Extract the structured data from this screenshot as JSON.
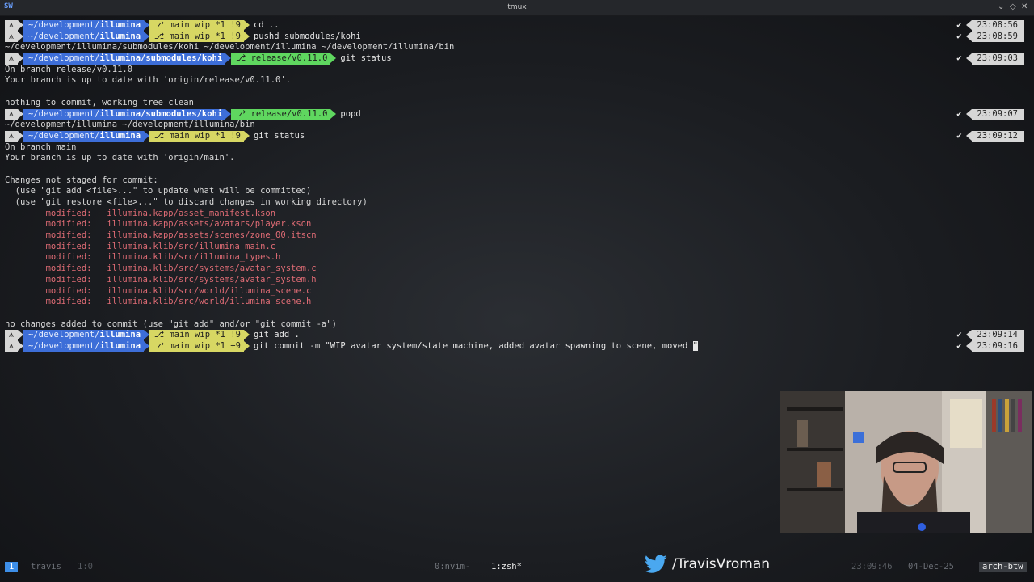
{
  "window": {
    "title": "tmux",
    "icon": "terminal-app-icon",
    "controls": [
      "chevron-down-icon",
      "diamond-icon",
      "close-icon"
    ]
  },
  "prompt": {
    "os_icon": "arch-linux-icon",
    "dir_prefix": "~/development/",
    "branch_icon": "branch-icon"
  },
  "terminal": {
    "lines": [
      {
        "type": "prompt",
        "dir": "illumina",
        "git": "⎇ main wip *1 !9",
        "clean": false,
        "cmd": "cd ..",
        "status": "✔",
        "time": "23:08:56"
      },
      {
        "type": "prompt",
        "dir": "illumina",
        "git": "⎇ main wip *1 !9",
        "clean": false,
        "cmd": "pushd submodules/kohi",
        "status": "✔",
        "time": "23:08:59"
      },
      {
        "type": "out",
        "text": "~/development/illumina/submodules/kohi ~/development/illumina ~/development/illumina/bin"
      },
      {
        "type": "prompt",
        "dir": "illumina/submodules/kohi",
        "git": "⎇ release/v0.11.0",
        "clean": true,
        "cmd": "git status",
        "status": "✔",
        "time": "23:09:03"
      },
      {
        "type": "out",
        "text": "On branch release/v0.11.0"
      },
      {
        "type": "out",
        "text": "Your branch is up to date with 'origin/release/v0.11.0'."
      },
      {
        "type": "out",
        "text": ""
      },
      {
        "type": "out",
        "text": "nothing to commit, working tree clean"
      },
      {
        "type": "prompt",
        "dir": "illumina/submodules/kohi",
        "git": "⎇ release/v0.11.0",
        "clean": true,
        "cmd": "popd",
        "status": "✔",
        "time": "23:09:07"
      },
      {
        "type": "out",
        "text": "~/development/illumina ~/development/illumina/bin"
      },
      {
        "type": "prompt",
        "dir": "illumina",
        "git": "⎇ main wip *1 !9",
        "clean": false,
        "cmd": "git status",
        "status": "✔",
        "time": "23:09:12"
      },
      {
        "type": "out",
        "text": "On branch main"
      },
      {
        "type": "out",
        "text": "Your branch is up to date with 'origin/main'."
      },
      {
        "type": "out",
        "text": ""
      },
      {
        "type": "out",
        "text": "Changes not staged for commit:"
      },
      {
        "type": "out",
        "text": "  (use \"git add <file>...\" to update what will be committed)"
      },
      {
        "type": "out",
        "text": "  (use \"git restore <file>...\" to discard changes in working directory)"
      },
      {
        "type": "mod",
        "text": "\tmodified:   illumina.kapp/asset_manifest.kson"
      },
      {
        "type": "mod",
        "text": "\tmodified:   illumina.kapp/assets/avatars/player.kson"
      },
      {
        "type": "mod",
        "text": "\tmodified:   illumina.kapp/assets/scenes/zone_00.itscn"
      },
      {
        "type": "mod",
        "text": "\tmodified:   illumina.klib/src/illumina_main.c"
      },
      {
        "type": "mod",
        "text": "\tmodified:   illumina.klib/src/illumina_types.h"
      },
      {
        "type": "mod",
        "text": "\tmodified:   illumina.klib/src/systems/avatar_system.c"
      },
      {
        "type": "mod",
        "text": "\tmodified:   illumina.klib/src/systems/avatar_system.h"
      },
      {
        "type": "mod",
        "text": "\tmodified:   illumina.klib/src/world/illumina_scene.c"
      },
      {
        "type": "mod",
        "text": "\tmodified:   illumina.klib/src/world/illumina_scene.h"
      },
      {
        "type": "out",
        "text": ""
      },
      {
        "type": "out",
        "text": "no changes added to commit (use \"git add\" and/or \"git commit -a\")"
      },
      {
        "type": "prompt",
        "dir": "illumina",
        "git": "⎇ main wip *1 !9",
        "clean": false,
        "cmd": "git add .",
        "status": "✔",
        "time": "23:09:14"
      },
      {
        "type": "prompt",
        "dir": "illumina",
        "git": "⎇ main wip *1 +9",
        "clean": false,
        "cmd": "git commit -m \"WIP avatar system/state machine, added avatar spawning to scene, moved ",
        "cursor": "\"",
        "status": "✔",
        "time": "23:09:16"
      }
    ]
  },
  "webcam": {
    "name": "webcam-overlay"
  },
  "social": {
    "icon": "twitter-bird-icon",
    "handle": "/TravisVroman"
  },
  "statusbar": {
    "session_number": "1",
    "session_name": "travis",
    "pane": "1:0",
    "windows": [
      "0:nvim-",
      "1:zsh*"
    ],
    "time": "23:09:46",
    "date": "04-Dec-25",
    "host": "arch-btw"
  },
  "colors": {
    "dir_segment": "#3d6ed8",
    "git_dirty": "#d7d763",
    "git_clean": "#5fd75f",
    "modified": "#e06c75",
    "status_accent": "#3d8ee8"
  }
}
